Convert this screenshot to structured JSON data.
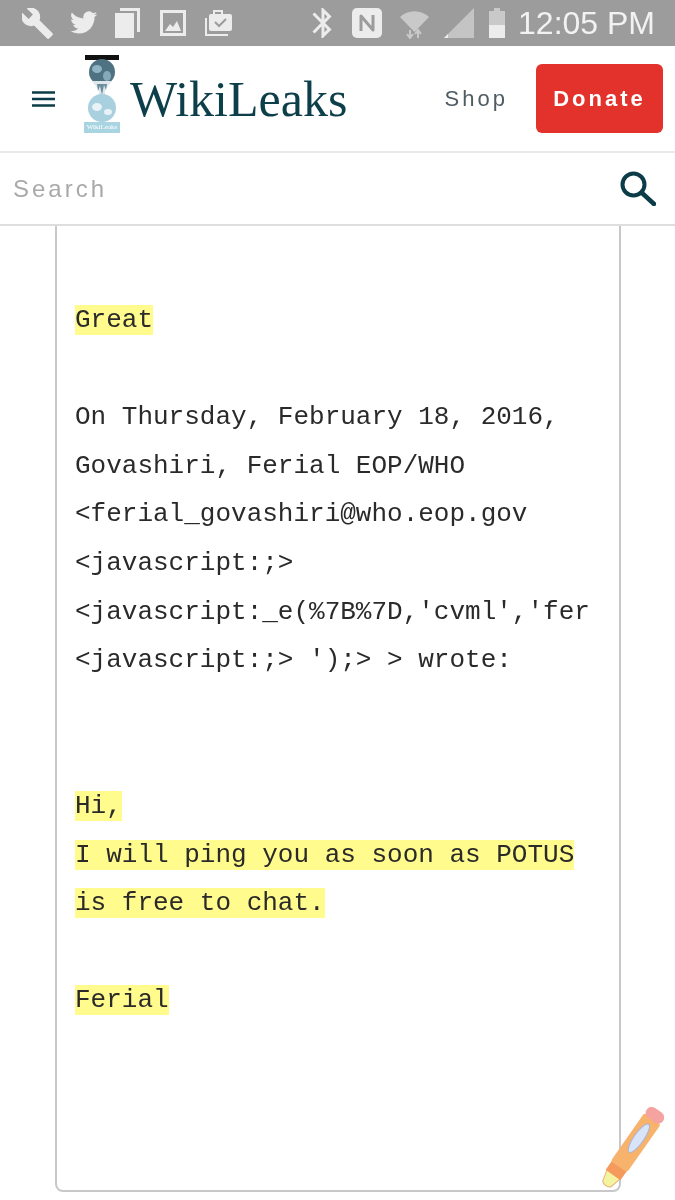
{
  "status_bar": {
    "time": "12:05 PM"
  },
  "header": {
    "logo_caption": "WikiLeaks",
    "title": "WikiLeaks",
    "shop_link": "Shop",
    "donate_button": "Donate"
  },
  "search": {
    "placeholder": "Search"
  },
  "email_body": {
    "blocks": [
      {
        "highlighted": true,
        "lines": [
          "Great"
        ]
      },
      {
        "highlighted": false,
        "lines": [
          "On Thursday, February 18, 2016,",
          "Govashiri, Ferial EOP/WHO",
          "<ferial_govashiri@who.eop.gov",
          "<javascript:;>",
          "<javascript:_e(%7B%7D,'cvml','fer",
          "<javascript:;> ');> > wrote:"
        ]
      },
      {
        "highlighted": true,
        "lines": [
          "Hi,",
          "I will ping you as soon as POTUS",
          "is free to chat."
        ]
      },
      {
        "highlighted": true,
        "lines": [
          "Ferial"
        ]
      }
    ]
  }
}
